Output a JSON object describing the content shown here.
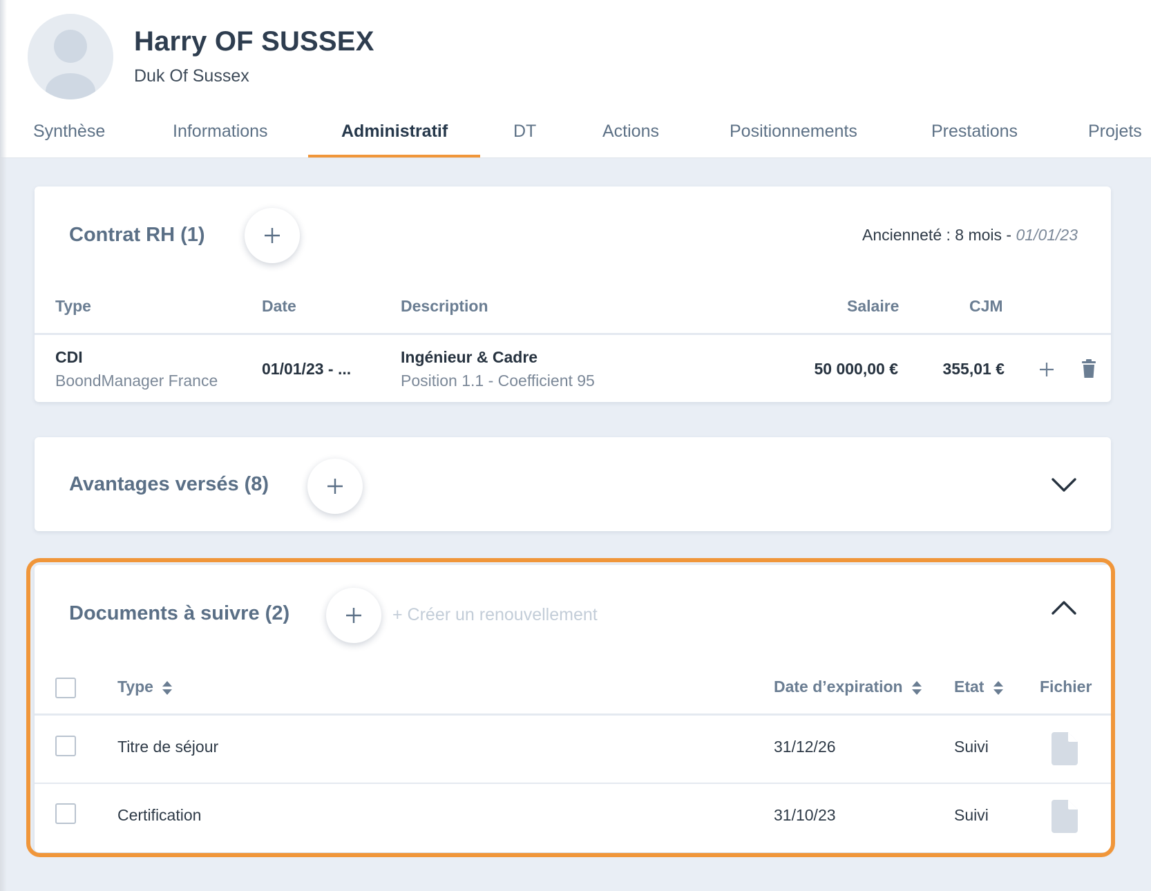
{
  "profile": {
    "name": "Harry OF SUSSEX",
    "title": "Duk Of Sussex"
  },
  "tabs": [
    {
      "label": "Synthèse"
    },
    {
      "label": "Informations"
    },
    {
      "label": "Administratif",
      "active": true
    },
    {
      "label": "DT"
    },
    {
      "label": "Actions"
    },
    {
      "label": "Positionnements"
    },
    {
      "label": "Prestations"
    },
    {
      "label": "Projets"
    }
  ],
  "contrat": {
    "title": "Contrat RH (1)",
    "anciennete_label": "Ancienneté : 8 mois - ",
    "anciennete_date": "01/01/23",
    "headers": {
      "type": "Type",
      "date": "Date",
      "description": "Description",
      "salaire": "Salaire",
      "cjm": "CJM"
    },
    "rows": [
      {
        "type": "CDI",
        "company": "BoondManager France",
        "date": "01/01/23 - ...",
        "description": "Ingénieur & Cadre",
        "position": "Position 1.1 - Coefficient 95",
        "salaire": "50 000,00 €",
        "cjm": "355,01 €"
      }
    ]
  },
  "avantages": {
    "title": "Avantages versés (8)"
  },
  "documents": {
    "title": "Documents à suivre (2)",
    "renew_link": "+ Créer un renouvellement",
    "headers": {
      "type": "Type",
      "expiration": "Date d’expiration",
      "etat": "Etat",
      "fichier": "Fichier"
    },
    "rows": [
      {
        "type": "Titre de séjour",
        "expiration": "31/12/26",
        "etat": "Suivi"
      },
      {
        "type": "Certification",
        "expiration": "31/10/23",
        "etat": "Suivi"
      }
    ]
  },
  "colors": {
    "accent": "#f0963a",
    "title_muted": "#5a6f86",
    "background": "#e9eef5"
  },
  "icons": [
    "avatar-placeholder-icon",
    "plus-icon",
    "trash-icon",
    "chevron-down-icon",
    "chevron-up-icon",
    "sort-icon",
    "file-icon"
  ]
}
